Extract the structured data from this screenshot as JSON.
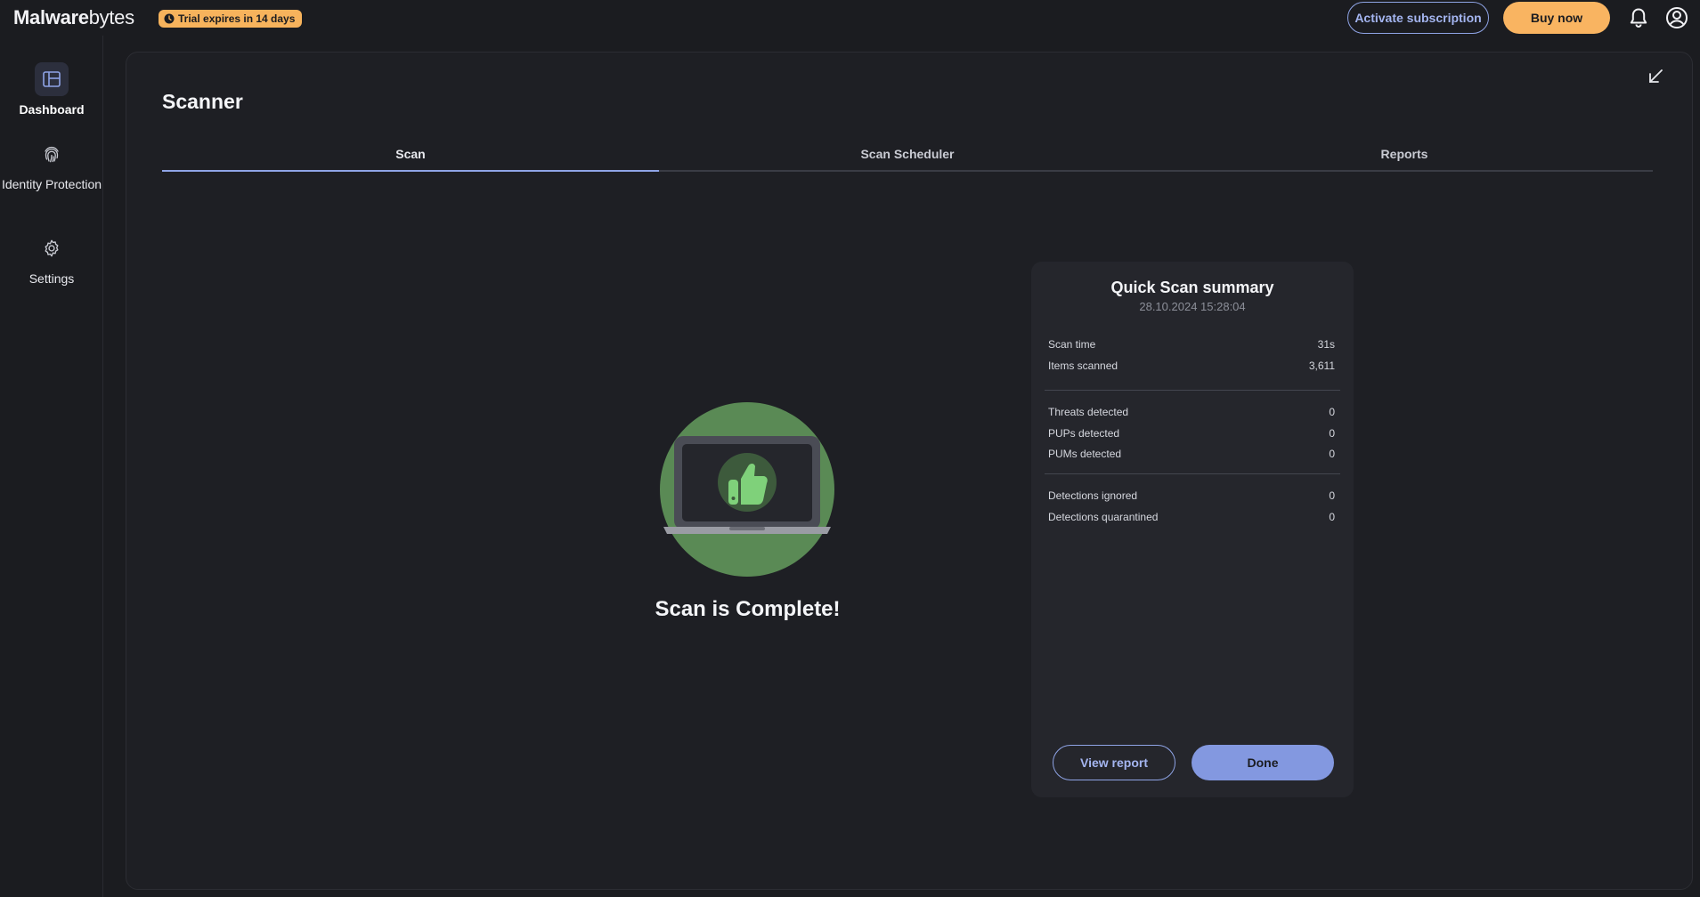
{
  "app": {
    "brand_bold": "M",
    "brand_mid": "alware",
    "brand_end": "bytes",
    "trial_badge": "Trial expires in 14 days"
  },
  "header": {
    "activate_label": "Activate subscription",
    "buy_label": "Buy now",
    "notifications_icon": "bell-icon",
    "account_icon": "account-icon"
  },
  "sidebar": {
    "items": [
      {
        "label": "Dashboard",
        "icon": "dashboard-icon",
        "active": true
      },
      {
        "label": "Identity Protection",
        "icon": "fingerprint-icon",
        "active": false
      },
      {
        "label": "Settings",
        "icon": "gear-icon",
        "active": false
      }
    ]
  },
  "main": {
    "title": "Scanner",
    "tabs": [
      {
        "label": "Scan",
        "active": true
      },
      {
        "label": "Scan Scheduler",
        "active": false
      },
      {
        "label": "Reports",
        "active": false
      }
    ],
    "status_text": "Scan is Complete!"
  },
  "summary": {
    "title": "Quick Scan summary",
    "date": "28.10.2024 15:28:04",
    "groups": [
      [
        {
          "label": "Scan time",
          "value": "31s"
        },
        {
          "label": "Items scanned",
          "value": "3,611"
        }
      ],
      [
        {
          "label": "Threats detected",
          "value": "0"
        },
        {
          "label": "PUPs detected",
          "value": "0"
        },
        {
          "label": "PUMs detected",
          "value": "0"
        }
      ],
      [
        {
          "label": "Detections ignored",
          "value": "0"
        },
        {
          "label": "Detections quarantined",
          "value": "0"
        }
      ]
    ],
    "view_report_label": "View report",
    "done_label": "Done"
  },
  "colors": {
    "accent": "#8fa4e6",
    "buy": "#f9b461",
    "success_green": "#5a8a55",
    "thumb_green": "#7fd17a"
  }
}
